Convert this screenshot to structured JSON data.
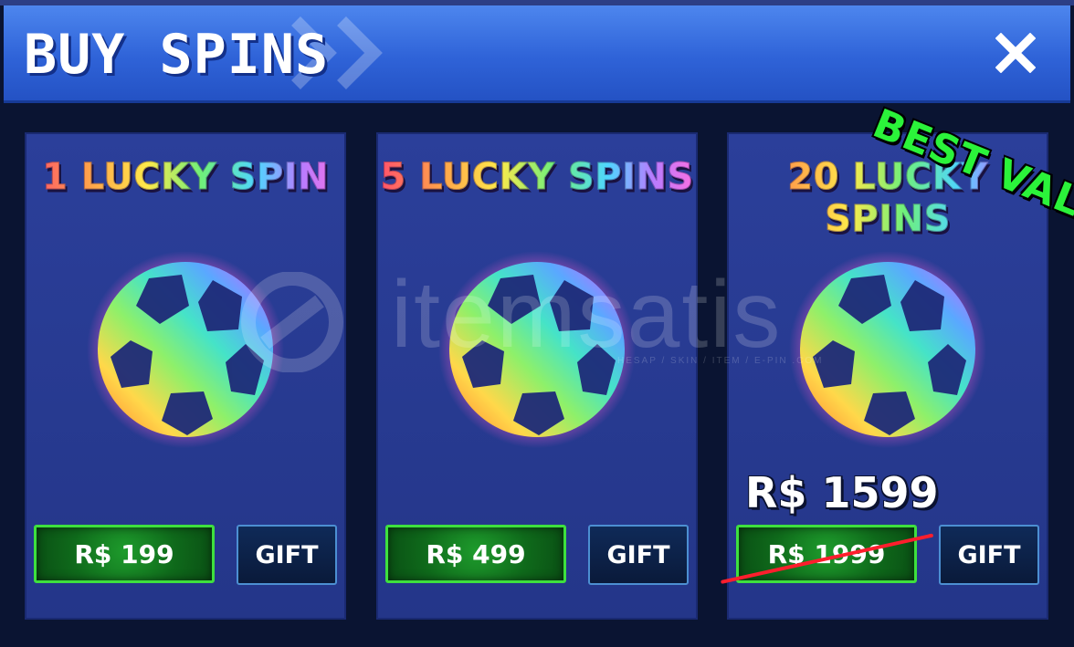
{
  "window": {
    "title": "BUY SPINS",
    "close_symbol": "✕"
  },
  "banner": {
    "text": "BEST VALUE",
    "color": "#2bf33a"
  },
  "cards": [
    {
      "title": "1 LUCKY SPIN",
      "price": "R$ 199",
      "gift": "GIFT"
    },
    {
      "title": "5 LUCKY SPINS",
      "price": "R$ 499",
      "gift": "GIFT"
    },
    {
      "title": "20 LUCKY SPINS",
      "price": "R$ 1999",
      "sale_price": "R$ 1599",
      "gift": "GIFT"
    }
  ],
  "icons": {
    "ball": "rainbow-soccer-ball-icon",
    "close": "close-icon"
  },
  "watermark": {
    "text": "itemsatis",
    "sub": "HESAP / SKIN / ITEM / E-PIN .COM"
  },
  "colors": {
    "header": "#3a72e4",
    "card": "#2b3f9a",
    "price_button": "#1e9b2c",
    "price_border": "#3ee03e",
    "gift_button": "#0f2a58",
    "strike": "#ff1e2d"
  }
}
